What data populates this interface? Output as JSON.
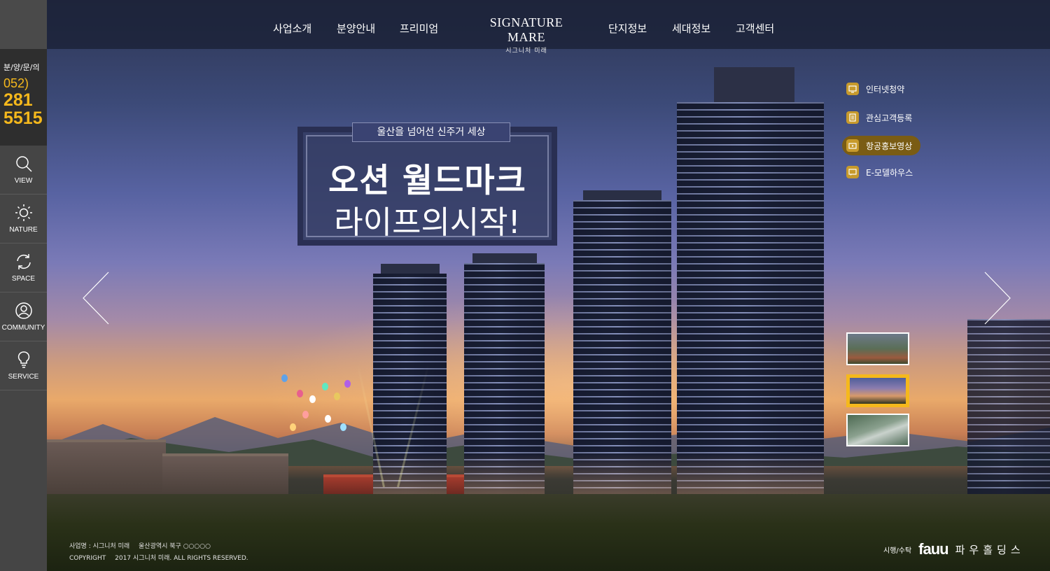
{
  "brand": {
    "name": "SIGNATURE MARE",
    "subtitle": "시그니처 미래"
  },
  "nav": {
    "items": [
      "사업소개",
      "분양안내",
      "프리미엄",
      "단지정보",
      "세대정보",
      "고객센터"
    ]
  },
  "sidebar": {
    "phone_title": "분/양/문/의",
    "phone_area": "052)",
    "phone_line1": "281",
    "phone_line2": "5515",
    "items": [
      {
        "label": "VIEW",
        "icon": "search-icon"
      },
      {
        "label": "NATURE",
        "icon": "sun-icon"
      },
      {
        "label": "SPACE",
        "icon": "refresh-icon"
      },
      {
        "label": "COMMUNITY",
        "icon": "user-icon"
      },
      {
        "label": "SERVICE",
        "icon": "lightbulb-icon"
      }
    ]
  },
  "hero": {
    "tagline": "울산을 넘어선 신주거 세상",
    "headline1": "오션 월드마크",
    "headline2": "라이프의시작!"
  },
  "quick_menu": [
    {
      "label": "인터넷청약",
      "icon": "monitor-icon",
      "active": false
    },
    {
      "label": "관심고객등록",
      "icon": "document-icon",
      "active": false
    },
    {
      "label": "항공홍보영상",
      "icon": "video-icon",
      "active": true
    },
    {
      "label": "E-모델하우스",
      "icon": "chat-icon",
      "active": false
    }
  ],
  "thumbnails": {
    "count": 3,
    "active_index": 1
  },
  "footer": {
    "business_label": "사업명 : 시그니처 미래",
    "address": "울산광역시 북구 ○○○○○",
    "copyright_label": "COPYRIGHT",
    "copyright_text": "2017 시그니처 미래. ALL RIGHTS RESERVED.",
    "builder_label": "시행/수탁",
    "builder_logo": "fauu",
    "builder_name": "파우홀딩스"
  },
  "colors": {
    "accent": "#f5b81c",
    "quick_icon": "#c79a2c",
    "sidebar_bg": "#454545",
    "nav_bg": "#1a2034"
  }
}
